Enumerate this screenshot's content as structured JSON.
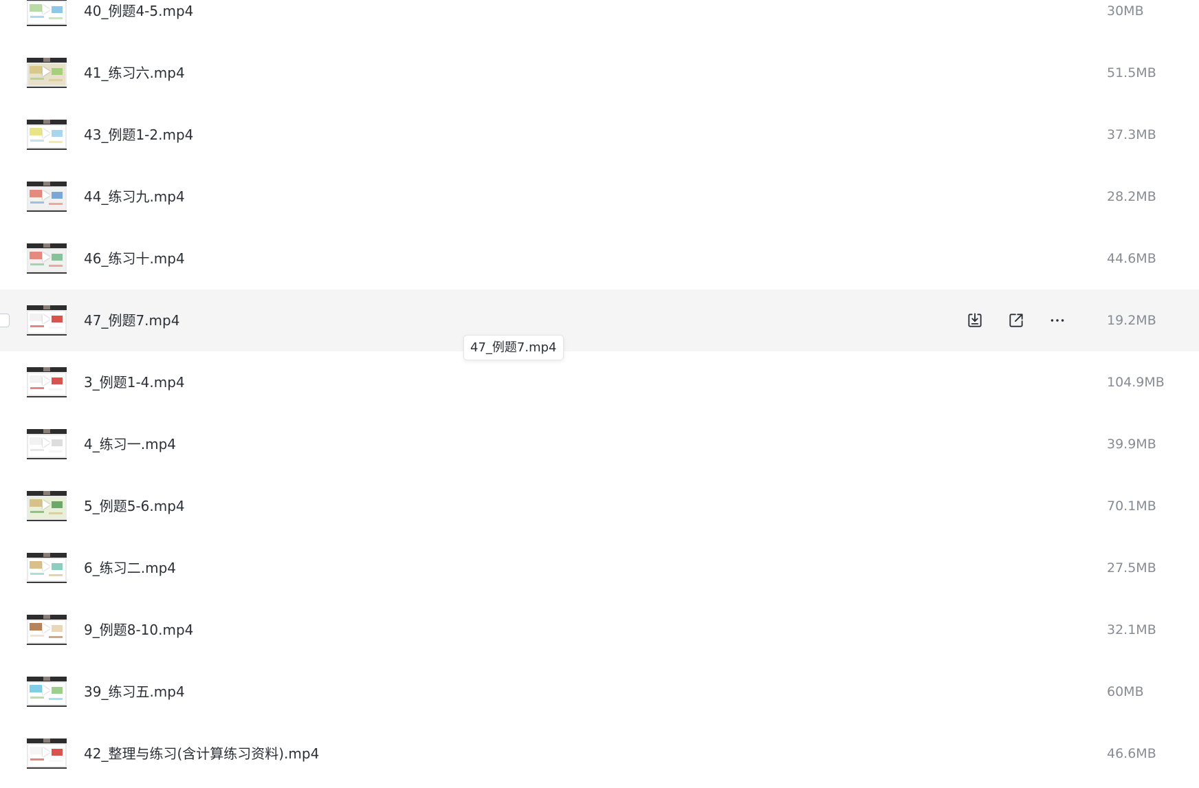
{
  "files": [
    {
      "name": "40_例题4-5.mp4",
      "size": "30MB",
      "thumb_colors": [
        "#b9dba5",
        "#8fc8e6",
        "#ffffff"
      ]
    },
    {
      "name": "41_练习六.mp4",
      "size": "51.5MB",
      "thumb_colors": [
        "#d8c98a",
        "#a5cf7a",
        "#e8e0c8"
      ]
    },
    {
      "name": "43_例题1-2.mp4",
      "size": "37.3MB",
      "thumb_colors": [
        "#e9e38a",
        "#a8d6f0",
        "#ffffff"
      ]
    },
    {
      "name": "44_练习九.mp4",
      "size": "28.2MB",
      "thumb_colors": [
        "#e58a7c",
        "#7aa6d8",
        "#f1f1f1"
      ]
    },
    {
      "name": "46_练习十.mp4",
      "size": "44.6MB",
      "thumb_colors": [
        "#e58a7c",
        "#86c39a",
        "#f1f1f1"
      ]
    },
    {
      "name": "47_例题7.mp4",
      "size": "19.2MB",
      "thumb_colors": [
        "#f2f2f2",
        "#d9534f",
        "#ffffff"
      ]
    },
    {
      "name": "3_例题1-4.mp4",
      "size": "104.9MB",
      "thumb_colors": [
        "#f2f2f2",
        "#d9534f",
        "#ffffff"
      ]
    },
    {
      "name": "4_练习一.mp4",
      "size": "39.9MB",
      "thumb_colors": [
        "#f2f2f2",
        "#dddddd",
        "#ffffff"
      ]
    },
    {
      "name": "5_例题5-6.mp4",
      "size": "70.1MB",
      "thumb_colors": [
        "#d9c08a",
        "#6da86a",
        "#e8f0d8"
      ]
    },
    {
      "name": "6_练习二.mp4",
      "size": "27.5MB",
      "thumb_colors": [
        "#d9c08a",
        "#8ccfc0",
        "#ffffff"
      ]
    },
    {
      "name": "9_例题8-10.mp4",
      "size": "32.1MB",
      "thumb_colors": [
        "#b6835a",
        "#e9d8b8",
        "#ffffff"
      ]
    },
    {
      "name": "39_练习五.mp4",
      "size": "60MB",
      "thumb_colors": [
        "#7fd0e6",
        "#9ccf8a",
        "#ffffff"
      ]
    },
    {
      "name": "42_整理与练习(含计算练习资料).mp4",
      "size": "46.6MB",
      "thumb_colors": [
        "#f5f5f5",
        "#d9534f",
        "#ffffff"
      ]
    }
  ],
  "hovered_index": 5,
  "row_actions": [
    {
      "icon": "download-icon"
    },
    {
      "icon": "share-icon"
    },
    {
      "icon": "more-icon"
    }
  ],
  "tooltip": {
    "text": "47_例题7.mp4"
  },
  "colors": {
    "hover_row": "#f5f5f6",
    "text": "#2b2f36",
    "size_text": "#878c93",
    "icon": "#2b2f36"
  }
}
